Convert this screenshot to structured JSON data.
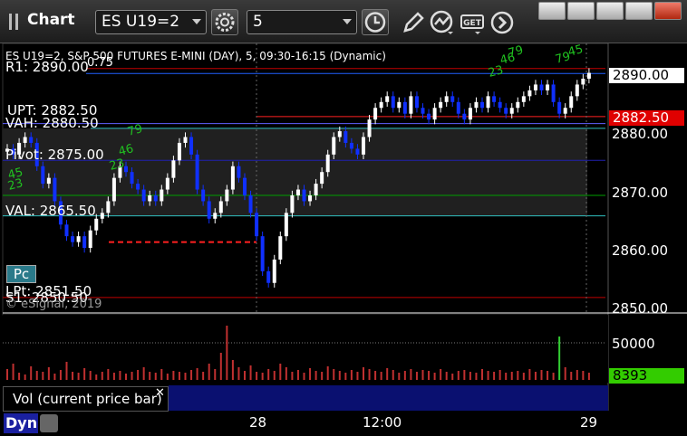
{
  "window": {
    "title": "Chart"
  },
  "toolbar": {
    "symbol": "ES U19=2",
    "interval": "5",
    "icons": [
      "gear-icon",
      "clock-icon",
      "pencil-icon",
      "line-study-icon",
      "get-icon",
      "next-icon"
    ]
  },
  "chart": {
    "header": "ES U19=2, S&P 500 FUTURES E-MINI (DAY), 5, 09:30-16:15 (Dynamic)",
    "copyright": "© eSignal, 2019",
    "pc_label": "Pc",
    "levels": {
      "r1": "R1: 2890.00",
      "r1_tail": "0.75",
      "upt": "UPT: 2882.50",
      "vah": "VAH: 2880.50",
      "pivot": "Pivot: 2875.00",
      "val": "VAL: 2865.50",
      "lpt": "LPt: 2851.50",
      "s1": "S1: 2850.50"
    },
    "price_axis": [
      "2890.00",
      "2880.00",
      "2870.00",
      "2860.00",
      "2850.00"
    ],
    "last_price_tag": "2890.00",
    "upt_tag": "2882.50",
    "time_axis": [
      "28",
      "12:00",
      "29"
    ],
    "markers": [
      "79",
      "46",
      "23",
      "45",
      "79",
      "79",
      "46",
      "23",
      "45",
      "23"
    ],
    "candles": [
      2877,
      2876,
      2878,
      2879,
      2878,
      2874,
      2871,
      2872,
      2868,
      2864,
      2862,
      2861,
      2862,
      2860,
      2863,
      2865,
      2866,
      2868,
      2872,
      2874,
      2873,
      2871,
      2870,
      2868,
      2869,
      2868,
      2870,
      2872,
      2875,
      2878,
      2879,
      2876,
      2870,
      2868,
      2865,
      2866,
      2868,
      2870,
      2874,
      2872,
      2869,
      2866,
      2862,
      2856,
      2854,
      2858,
      2862,
      2866,
      2869,
      2870,
      2868,
      2869,
      2871,
      2873,
      2876,
      2879,
      2880,
      2878,
      2877,
      2876,
      2879,
      2882,
      2884,
      2885,
      2886,
      2884,
      2885,
      2883,
      2886,
      2884,
      2883,
      2882,
      2884,
      2885,
      2886,
      2885,
      2883,
      2882,
      2884,
      2885,
      2884,
      2886,
      2885,
      2884,
      2883,
      2884,
      2885,
      2886,
      2887,
      2888,
      2887,
      2888,
      2885,
      2883,
      2884,
      2886,
      2888,
      2889,
      2890
    ]
  },
  "volume": {
    "panel_label": "Vol (current price bar)",
    "axis": [
      "50000"
    ],
    "current_value": "8393",
    "bars": [
      12,
      18,
      8,
      6,
      15,
      10,
      9,
      14,
      7,
      11,
      20,
      9,
      8,
      13,
      10,
      6,
      9,
      12,
      8,
      10,
      7,
      9,
      11,
      14,
      9,
      8,
      12,
      7,
      10,
      9,
      8,
      11,
      13,
      9,
      18,
      12,
      30,
      60,
      22,
      14,
      10,
      16,
      9,
      8,
      12,
      10,
      18,
      14,
      9,
      11,
      8,
      13,
      10,
      9,
      15,
      12,
      10,
      8,
      11,
      9,
      14,
      12,
      10,
      9,
      13,
      11,
      8,
      10,
      12,
      9,
      11,
      10,
      8,
      12,
      9,
      7,
      10,
      11,
      9,
      8,
      12,
      10,
      9,
      11,
      8,
      9,
      10,
      8,
      12,
      9,
      11,
      10,
      8,
      48,
      14,
      9,
      11,
      10,
      8
    ]
  },
  "bottom": {
    "label": "Dyn"
  },
  "colors": {
    "up": "#ffffff",
    "down": "#1030ff",
    "r1": "#c00000",
    "upt": "#ff2020",
    "vah": "#6060ff",
    "pivot": "#2020b0",
    "val": "#30c0c0",
    "lpt": "#00a000",
    "s1": "#c00000",
    "volume": "#c03030"
  }
}
